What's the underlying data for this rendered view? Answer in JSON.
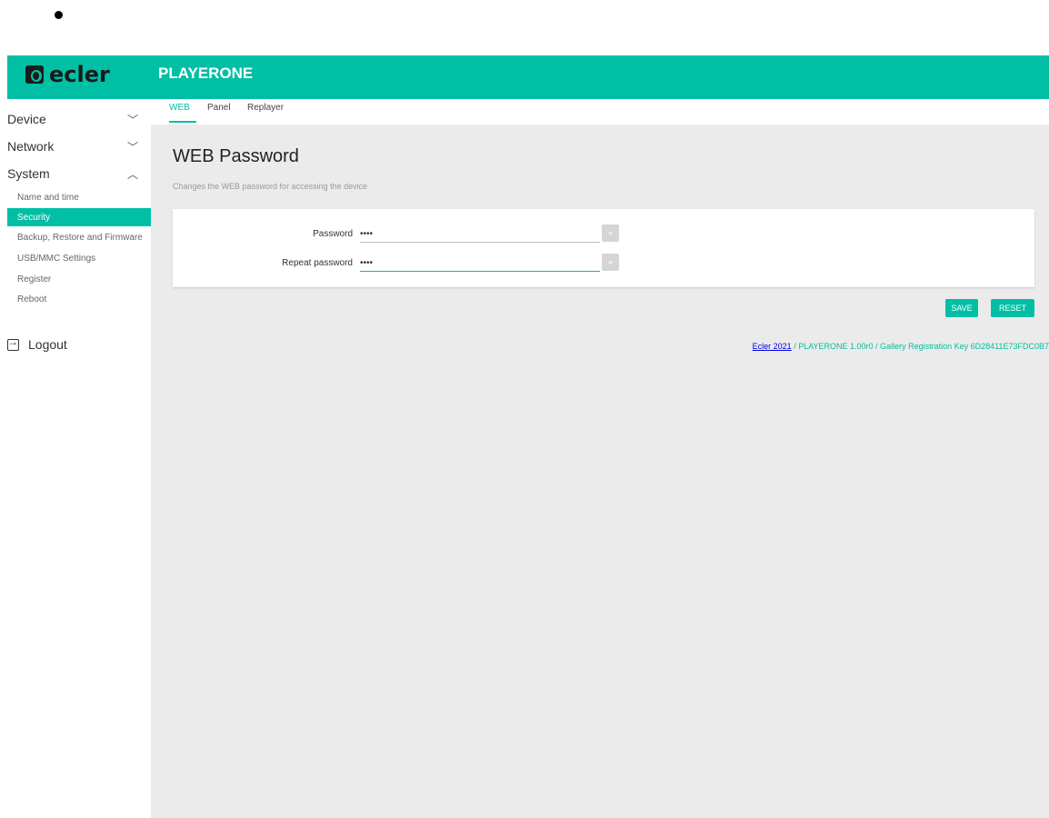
{
  "brand": {
    "logo_text": "ecler",
    "app_title": "PLAYERONE"
  },
  "sidebar": {
    "groups": [
      {
        "label": "Device",
        "chevron": "chevron-down-icon"
      },
      {
        "label": "Network",
        "chevron": "chevron-down-icon"
      },
      {
        "label": "System",
        "chevron": "chevron-up-icon"
      }
    ],
    "items": [
      {
        "label": "Name and time"
      },
      {
        "label": "Security",
        "active": true
      },
      {
        "label": "Backup, Restore and Firmware"
      },
      {
        "label": "USB/MMC Settings"
      },
      {
        "label": "Register"
      },
      {
        "label": "Reboot"
      }
    ],
    "logout_label": "Logout"
  },
  "tabs": [
    {
      "label": "WEB",
      "active": true
    },
    {
      "label": "Panel"
    },
    {
      "label": "Replayer"
    }
  ],
  "page": {
    "title": "WEB Password",
    "description": "Changes the WEB password for accessing the device"
  },
  "form": {
    "password_label": "Password",
    "password_value": "••••",
    "repeat_label": "Repeat password",
    "repeat_value": "••••"
  },
  "buttons": {
    "save": "SAVE",
    "reset": "RESET"
  },
  "footer": {
    "link": "Ecler 2021",
    "text": " / PLAYERONE 1.00r0 / Gallery Registration Key 6D28411E73FDC0B7"
  },
  "colors": {
    "accent": "#00bfa5",
    "background": "#ebebeb"
  }
}
